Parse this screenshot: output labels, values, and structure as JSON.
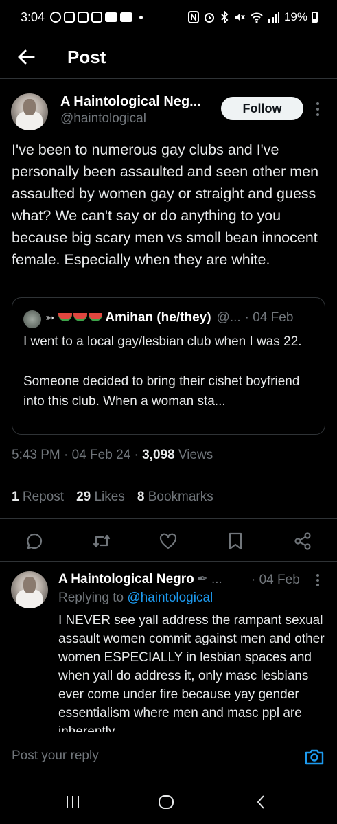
{
  "status_bar": {
    "time": "3:04",
    "battery": "19%"
  },
  "header": {
    "title": "Post"
  },
  "tweet": {
    "author": "A Haintological Neg...",
    "handle": "@haintological",
    "follow_label": "Follow",
    "text": "I've been to numerous gay clubs and I've personally been assaulted and seen other men assaulted by women gay or straight and guess what? We can't say or do anything to you because big scary men vs smoll bean innocent female. Especially when they are white.",
    "quote": {
      "badge": "➳",
      "name": "Amihan (he/they)",
      "handle": "@...",
      "date": "· 04 Feb",
      "text_line1": "I went to a local gay/lesbian club when I was 22.",
      "text_line2": "Someone decided to bring their cishet boyfriend into this club. When a woman sta..."
    },
    "time": "5:43 PM · 04 Feb 24 · ",
    "views_count": "3,098",
    "views_label": " Views",
    "stats": {
      "reposts_count": "1",
      "reposts_label": "Repost",
      "likes_count": "29",
      "likes_label": "Likes",
      "bookmarks_count": "8",
      "bookmarks_label": "Bookmarks"
    }
  },
  "reply": {
    "author": "A Haintological Negro",
    "author_extra": "✒ ...",
    "date": "· 04 Feb",
    "replying_to_label": "Replying to ",
    "replying_to_handle": "@haintological",
    "text": "I NEVER see yall address the rampant sexual assault women commit against men and other women ESPECIALLY in lesbian spaces and when yall do address it, only masc lesbians ever come under fire because yay gender essentialism where men and masc ppl are inherently"
  },
  "compose": {
    "placeholder": "Post your reply"
  },
  "colors": {
    "accent": "#1d9bf0",
    "muted": "#71767b",
    "background": "#000000"
  },
  "icons": [
    "back-arrow-icon",
    "more-vertical-icon",
    "reply-icon",
    "repost-icon",
    "like-icon",
    "bookmark-icon",
    "share-icon",
    "camera-icon",
    "recents-icon",
    "home-icon",
    "back-icon"
  ]
}
